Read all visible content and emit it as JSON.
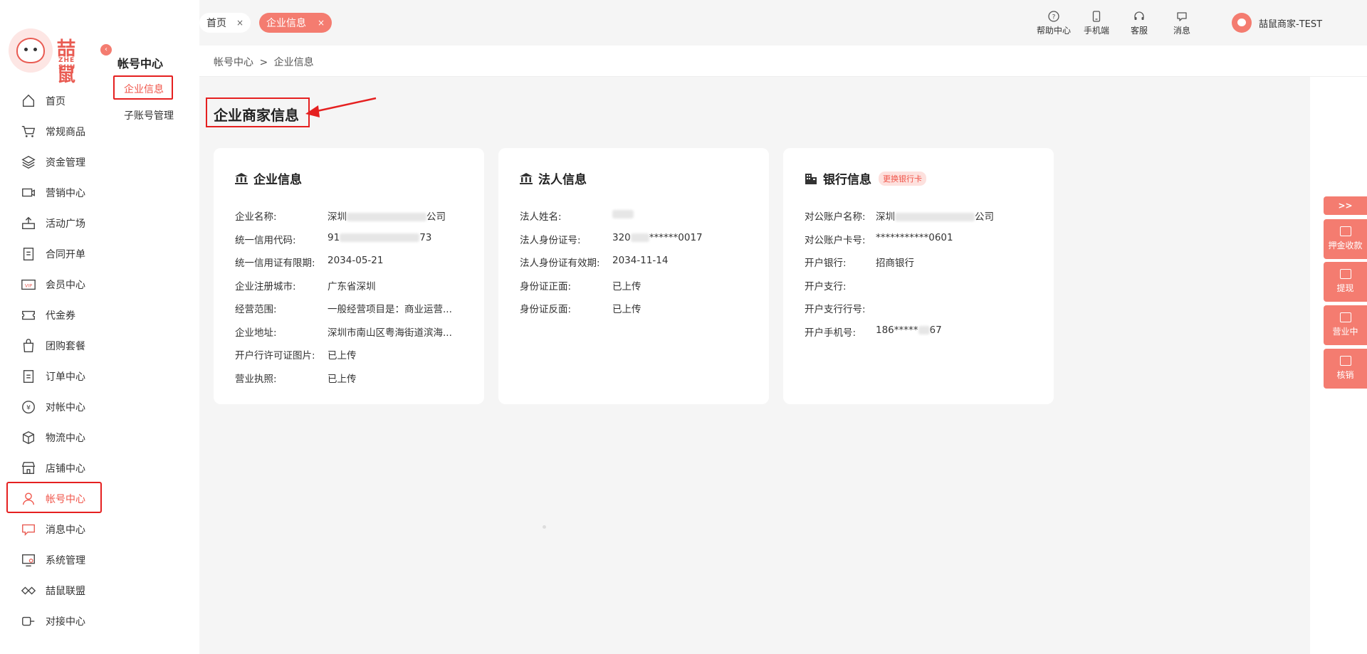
{
  "brand": {
    "name_cn": "喆鼠",
    "name_en": "ZHE SHU"
  },
  "sidebar": {
    "items": [
      {
        "label": "首页",
        "icon": "home-icon"
      },
      {
        "label": "常规商品",
        "icon": "cart-icon"
      },
      {
        "label": "资金管理",
        "icon": "layers-icon"
      },
      {
        "label": "营销中心",
        "icon": "marketing-icon"
      },
      {
        "label": "活动广场",
        "icon": "activity-icon"
      },
      {
        "label": "合同开单",
        "icon": "contract-icon"
      },
      {
        "label": "会员中心",
        "icon": "vip-icon"
      },
      {
        "label": "代金券",
        "icon": "coupon-icon"
      },
      {
        "label": "团购套餐",
        "icon": "bag-icon"
      },
      {
        "label": "订单中心",
        "icon": "order-icon"
      },
      {
        "label": "对帐中心",
        "icon": "yuan-icon"
      },
      {
        "label": "物流中心",
        "icon": "box-icon"
      },
      {
        "label": "店铺中心",
        "icon": "store-icon"
      },
      {
        "label": "帐号中心",
        "icon": "user-icon"
      },
      {
        "label": "消息中心",
        "icon": "message-icon"
      },
      {
        "label": "系统管理",
        "icon": "system-icon"
      },
      {
        "label": "喆鼠联盟",
        "icon": "alliance-icon"
      },
      {
        "label": "对接中心",
        "icon": "connect-icon"
      }
    ],
    "active_index": 13
  },
  "subnav": {
    "title": "帐号中心",
    "items": [
      {
        "label": "企业信息"
      },
      {
        "label": "子账号管理"
      }
    ]
  },
  "tabs": [
    {
      "label": "首页",
      "close": "×"
    },
    {
      "label": "企业信息",
      "close": "×"
    }
  ],
  "header": {
    "icons": [
      {
        "label": "帮助中心",
        "icon": "help-icon"
      },
      {
        "label": "手机端",
        "icon": "mobile-icon"
      },
      {
        "label": "客服",
        "icon": "headset-icon"
      },
      {
        "label": "消息",
        "icon": "chat-icon"
      }
    ],
    "user": "喆鼠商家-TEST"
  },
  "breadcrumb": {
    "parent": "帐号中心",
    "sep": ">",
    "current": "企业信息"
  },
  "page": {
    "title": "企业商家信息"
  },
  "cards": {
    "company": {
      "title": "企业信息",
      "rows": [
        {
          "key": "企业名称:",
          "pre": "深圳",
          "post": "公司"
        },
        {
          "key": "统一信用代码:",
          "pre": "91",
          "post": "73"
        },
        {
          "key": "统一信用证有限期:",
          "value": "2034-05-21"
        },
        {
          "key": "企业注册城市:",
          "value": "广东省深圳"
        },
        {
          "key": "经营范围:",
          "value": "一般经营项目是：商业运营..."
        },
        {
          "key": "企业地址:",
          "value": "深圳市南山区粤海街道滨海..."
        },
        {
          "key": "开户行许可证图片:",
          "value": "已上传"
        },
        {
          "key": "营业执照:",
          "value": "已上传"
        }
      ]
    },
    "legal": {
      "title": "法人信息",
      "rows": [
        {
          "key": "法人姓名:",
          "pre": "",
          "post": ""
        },
        {
          "key": "法人身份证号:",
          "pre": "320",
          "post": "******0017"
        },
        {
          "key": "法人身份证有效期:",
          "value": "2034-11-14"
        },
        {
          "key": "身份证正面:",
          "value": "已上传"
        },
        {
          "key": "身份证反面:",
          "value": "已上传"
        }
      ]
    },
    "bank": {
      "title": "银行信息",
      "tag": "更换银行卡",
      "rows": [
        {
          "key": "对公账户名称:",
          "pre": "深圳",
          "post": "公司"
        },
        {
          "key": "对公账户卡号:",
          "value": "***********0601"
        },
        {
          "key": "开户银行:",
          "value": "招商银行"
        },
        {
          "key": "开户支行:",
          "value": ""
        },
        {
          "key": "开户支行行号:",
          "value": ""
        },
        {
          "key": "开户手机号:",
          "pre": "186*****",
          "post": "67"
        }
      ]
    }
  },
  "float_buttons": [
    {
      "label": ">>"
    },
    {
      "label": "押金收款"
    },
    {
      "label": "提现"
    },
    {
      "label": "营业中"
    },
    {
      "label": "核销"
    }
  ],
  "colors": {
    "accent": "#f47c70",
    "active_text": "#f0554a",
    "annotation_red": "#e52020"
  }
}
